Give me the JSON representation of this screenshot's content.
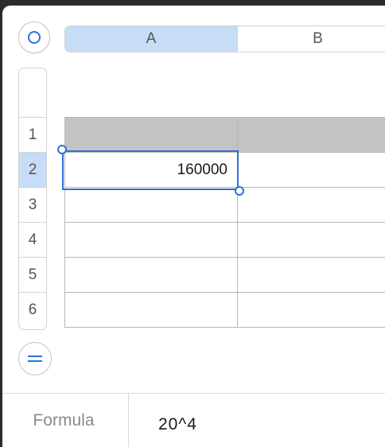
{
  "columns": [
    {
      "label": "A",
      "selected": true
    },
    {
      "label": "B",
      "selected": false
    }
  ],
  "rows": [
    {
      "label": "1",
      "selected": false
    },
    {
      "label": "2",
      "selected": true
    },
    {
      "label": "3",
      "selected": false
    },
    {
      "label": "4",
      "selected": false
    },
    {
      "label": "5",
      "selected": false
    },
    {
      "label": "6",
      "selected": false
    }
  ],
  "cells": {
    "r1": [
      "",
      ""
    ],
    "r2": [
      "160000",
      ""
    ],
    "r3": [
      "",
      ""
    ],
    "r4": [
      "",
      ""
    ],
    "r5": [
      "",
      ""
    ],
    "r6": [
      "",
      ""
    ]
  },
  "formula_bar": {
    "label": "Formula",
    "value": "20^4"
  },
  "icons": {
    "select_all": "circle-select-icon",
    "formula_toggle": "equals-icon"
  },
  "colors": {
    "accent": "#2f6fdd",
    "selected_header": "#c7dcf6",
    "header_row": "#c3c3c3"
  }
}
